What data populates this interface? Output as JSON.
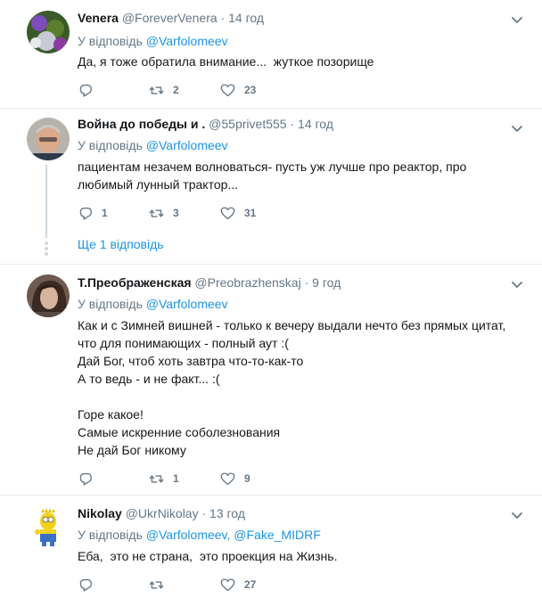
{
  "reply_prefix": "У відповідь",
  "tweets": [
    {
      "name": "Venera",
      "handle": "@ForeverVenera",
      "dot": "·",
      "time": "14 год",
      "reply_to": [
        "@Varfolomeev"
      ],
      "text": [
        "Да, я тоже обратилa внимание...  жуткое позорище"
      ],
      "replies": "",
      "retweets": "2",
      "likes": "23"
    },
    {
      "name": "Война до победы и .",
      "handle": "@55privet555",
      "dot": "·",
      "time": "14 год",
      "reply_to": [
        "@Varfolomeev"
      ],
      "text": [
        "пациентам незачем волноваться- пусть уж лучше про реактор, про",
        "любимый лунный трактор..."
      ],
      "replies": "1",
      "retweets": "3",
      "likes": "31",
      "more_replies": "Ще 1 відповідь"
    },
    {
      "name": "Т.Преображенская",
      "handle": "@Preobrazhenskaj",
      "dot": "·",
      "time": "9 год",
      "reply_to": [
        "@Varfolomeev"
      ],
      "text": [
        "Как и с Зимней вишней - только к вечеру выдали нечто без прямых цитат,",
        "что для понимающих - полный аут :(",
        "Дай Бог, чтоб хоть завтра что-то-как-то",
        "А то ведь - и не факт... :(",
        "",
        "Горе какое!",
        "Самые искренние соболезнования",
        "Не дай Бог никому"
      ],
      "replies": "",
      "retweets": "1",
      "likes": "9"
    },
    {
      "name": "Nikolay",
      "handle": "@UkrNikolay",
      "dot": "·",
      "time": "13 год",
      "reply_to": [
        "@Varfolomeev,",
        "@Fake_MIDRF"
      ],
      "text": [
        "Еба,  это не страна,  это проекция на Жизнь."
      ],
      "replies": "",
      "retweets": "",
      "likes": "27"
    }
  ],
  "colors": {
    "link": "#1b95e0",
    "muted": "#657786",
    "text": "#14171a",
    "border": "#e6ecf0"
  }
}
